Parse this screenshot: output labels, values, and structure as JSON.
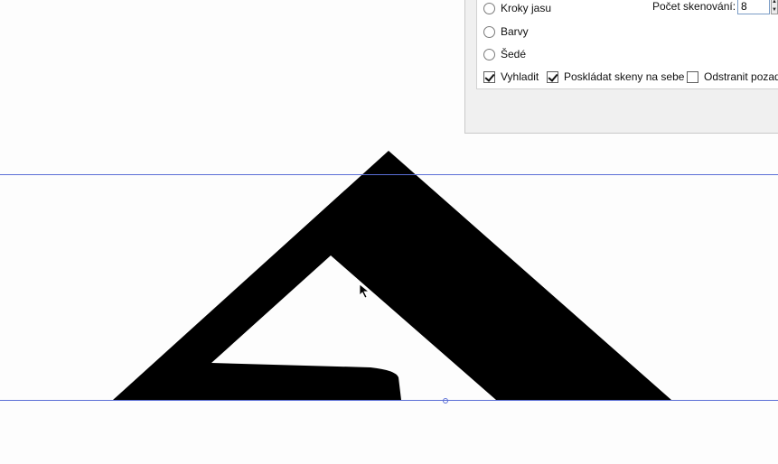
{
  "trace_panel": {
    "mode_options": [
      {
        "label": "Kroky jasu",
        "selected": false
      },
      {
        "label": "Barvy",
        "selected": false
      },
      {
        "label": "Šedé",
        "selected": false
      }
    ],
    "scan_count": {
      "label": "Počet skenování:",
      "value": "8"
    },
    "checkboxes": [
      {
        "label": "Vyhladit",
        "checked": true
      },
      {
        "label": "Poskládat skeny na sebe",
        "checked": true
      },
      {
        "label": "Odstranit pozad",
        "checked": false
      }
    ]
  },
  "canvas": {
    "guide_color": "#5b6fd6",
    "shape_fill": "#000000"
  }
}
